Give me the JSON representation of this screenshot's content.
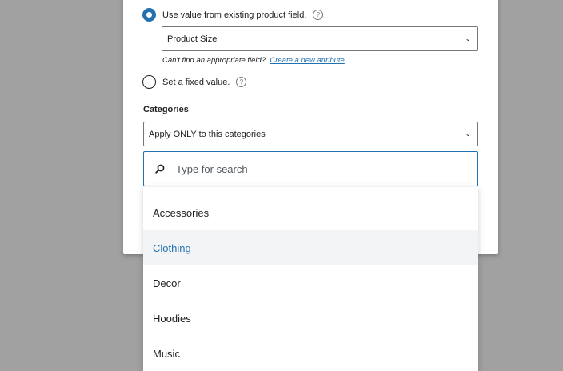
{
  "source_field": {
    "option_existing_label": "Use value from existing product field.",
    "option_existing_selected": true,
    "product_field_select_value": "Product Size",
    "hint_text": "Can't find an appropriate field?.",
    "hint_link": "Create a new attribute",
    "option_fixed_label": "Set a fixed value.",
    "option_fixed_selected": false
  },
  "categories": {
    "label": "Categories",
    "scope_select_value": "Apply ONLY to this categories",
    "search_placeholder": "Type for search",
    "options": [
      {
        "label": "Accessories",
        "highlighted": false
      },
      {
        "label": "Clothing",
        "highlighted": true
      },
      {
        "label": "Decor",
        "highlighted": false
      },
      {
        "label": "Hoodies",
        "highlighted": false
      },
      {
        "label": "Music",
        "highlighted": false
      }
    ]
  },
  "colors": {
    "accent": "#2271b1",
    "backdrop": "#a1a1a1",
    "highlight_bg": "#f3f4f5"
  },
  "icons": {
    "help": "question-circle-icon",
    "chevron": "chevron-down-icon",
    "search": "search-icon"
  }
}
